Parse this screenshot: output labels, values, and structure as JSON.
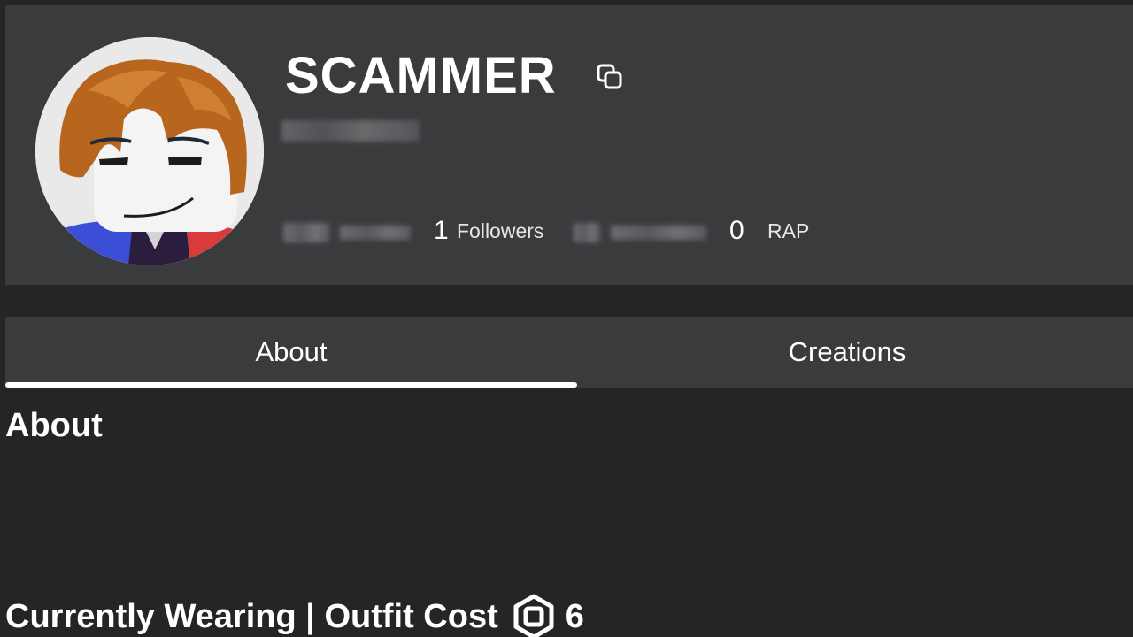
{
  "profile": {
    "username": "SCAMMER",
    "display_name": "",
    "stats": [
      {
        "value": "",
        "label": "",
        "blurred": true
      },
      {
        "value": "1",
        "label": "Followers",
        "blurred": false
      },
      {
        "value": "",
        "label": "",
        "blurred": true
      },
      {
        "value": "0",
        "label": "RAP",
        "blurred": false
      }
    ]
  },
  "tabs": [
    {
      "label": "About",
      "active": true
    },
    {
      "label": "Creations",
      "active": false
    }
  ],
  "about": {
    "heading": "About"
  },
  "wearing": {
    "heading": "Currently Wearing | Outfit Cost",
    "cost": "6",
    "currency_icon": "robux-icon"
  },
  "colors": {
    "background": "#232527",
    "card": "#393b3d",
    "text": "#ffffff",
    "active_tab_indicator": "#ffffff"
  }
}
